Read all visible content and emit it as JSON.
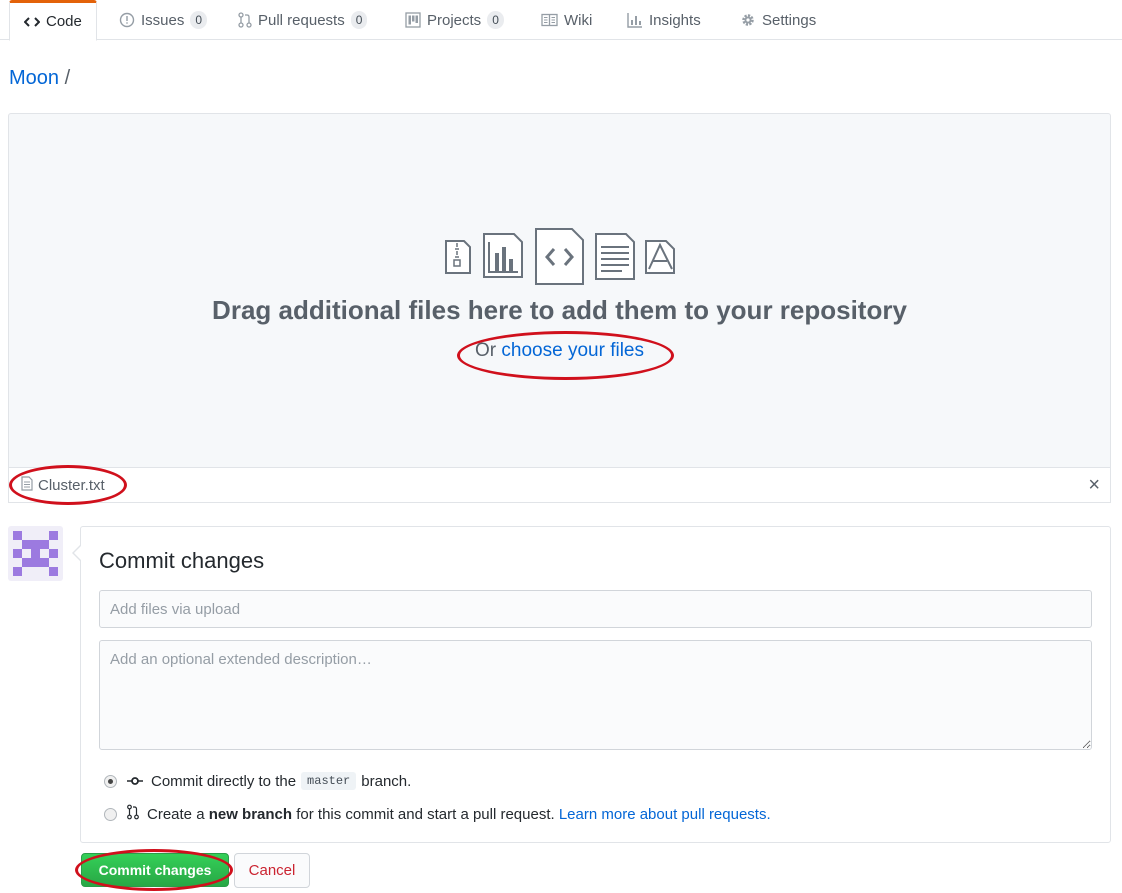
{
  "tabs": [
    {
      "label": "Code",
      "icon": "code-icon",
      "count": null
    },
    {
      "label": "Issues",
      "icon": "issue-icon",
      "count": "0"
    },
    {
      "label": "Pull requests",
      "icon": "pull-request-icon",
      "count": "0"
    },
    {
      "label": "Projects",
      "icon": "project-icon",
      "count": "0"
    },
    {
      "label": "Wiki",
      "icon": "book-icon",
      "count": null
    },
    {
      "label": "Insights",
      "icon": "graph-icon",
      "count": null
    },
    {
      "label": "Settings",
      "icon": "gear-icon",
      "count": null
    }
  ],
  "breadcrumb": {
    "owner": "Moon",
    "separator": "/"
  },
  "dropzone": {
    "title": "Drag additional files here to add them to your repository",
    "or_text": "Or ",
    "choose_link": "choose your files",
    "icons": [
      "zip-file-icon",
      "chart-file-icon",
      "code-file-icon",
      "text-file-icon",
      "pdf-file-icon"
    ]
  },
  "files": [
    {
      "name": "Cluster.txt",
      "remove_label": "×"
    }
  ],
  "commit": {
    "title": "Commit changes",
    "summary_placeholder": "Add files via upload",
    "description_placeholder": "Add an optional extended description…",
    "options": [
      {
        "prefix": "Commit directly to the",
        "branch": "master",
        "suffix": "branch.",
        "checked": true
      },
      {
        "prefix": "Create a ",
        "bold": "new branch",
        "suffix": " for this commit and start a pull request. ",
        "link": "Learn more about pull requests."
      }
    ],
    "submit_label": "Commit changes",
    "cancel_label": "Cancel"
  },
  "colors": {
    "accent": "#0366d6",
    "submit": "#28a745",
    "cancel": "#cb2431",
    "annotation": "#d0101c",
    "tab_selected": "#e36209"
  }
}
